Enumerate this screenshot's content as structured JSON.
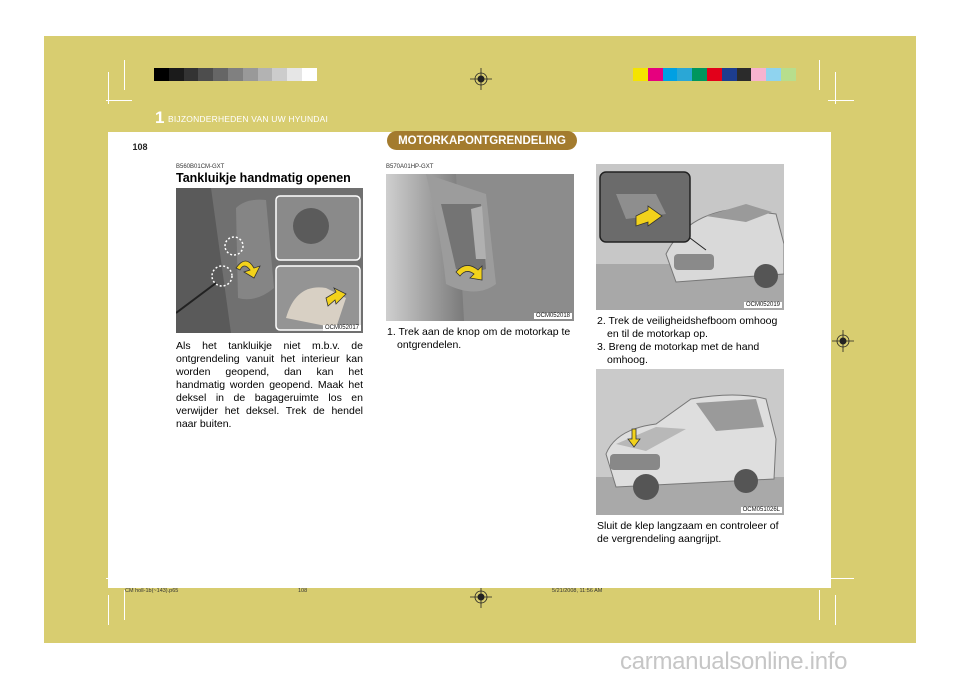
{
  "header": {
    "chapter_number": "1",
    "chapter_title": "BIJZONDERHEDEN VAN UW HYUNDAI",
    "page_number": "108",
    "section_title": "MOTORKAPONTGRENDELING"
  },
  "left_column": {
    "code": "B560B01CM-GXT",
    "title": "Tankluikje handmatig openen",
    "image_caption": "OCM052017",
    "text": "Als het tankluikje niet m.b.v. de ontgrendeling vanuit het interieur kan worden geopend, dan kan het handmatig worden geopend. Maak het deksel in de bagageruimte los en verwijder het deksel. Trek de hendel naar buiten."
  },
  "middle_column": {
    "code": "B570A01HP-GXT",
    "image_caption": "OCM052018",
    "step1": "1. Trek aan de knop om de motorkap te ontgrendelen."
  },
  "right_column": {
    "image1_caption": "OCM052019",
    "step2": "2. Trek de veiligheidshefboom omhoog en til de motorkap op.",
    "step3": "3. Breng de motorkap met de hand omhoog.",
    "image2_caption": "OCM051026L",
    "closing_text": "Sluit de klep langzaam en controleer of de vergrendeling aangrijpt."
  },
  "footer": {
    "file": "CM holl-1b(~143).p65",
    "page": "108",
    "datetime": "5/21/2008, 11:56 AM"
  },
  "watermark": "carmanualsonline.info",
  "colors": {
    "band": "#d8cd70",
    "pill": "#a37b2e",
    "arrow": "#f2d21b"
  }
}
